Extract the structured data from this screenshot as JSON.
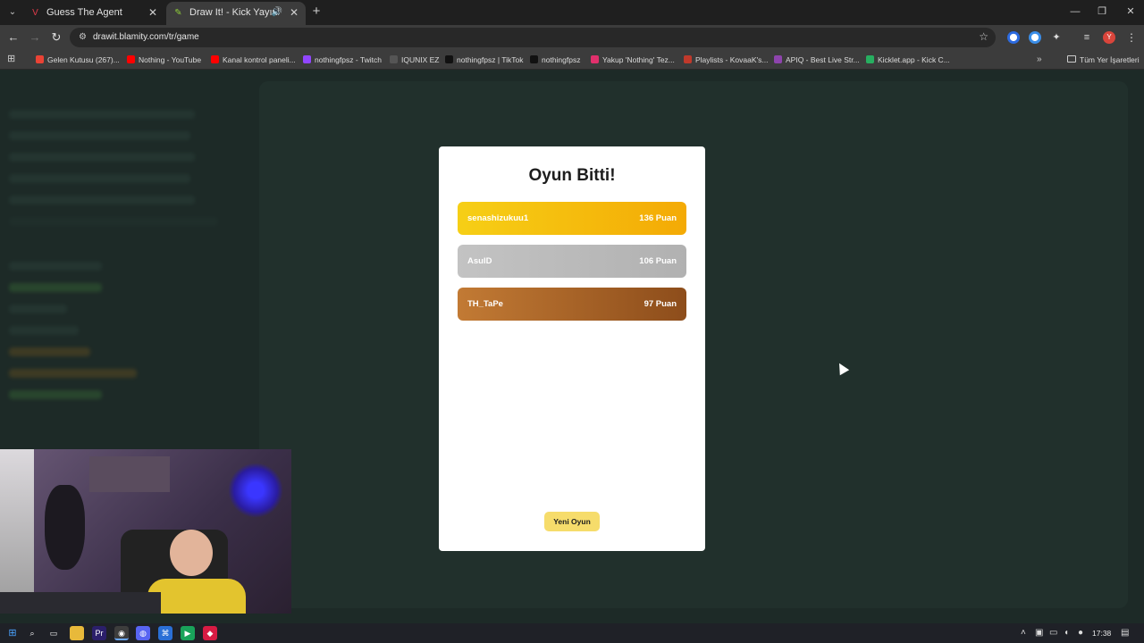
{
  "browser": {
    "tabs": [
      {
        "title": "Guess The Agent",
        "active": false,
        "favicon": "valorant-icon",
        "favicon_color": "#e23b4b"
      },
      {
        "title": "Draw It! - Kick Yayınları İçin",
        "active": true,
        "favicon": "pencil-icon",
        "favicon_color": "#8fce3a",
        "audio": true
      }
    ],
    "url": "drawit.blamity.com/tr/game",
    "profile_initial": "Y"
  },
  "bookmarks": [
    {
      "label": "Gelen Kutusu (267)...",
      "icon": "gmail-icon",
      "color": "#ea4335"
    },
    {
      "label": "Nothing - YouTube",
      "icon": "youtube-icon",
      "color": "#ff0000"
    },
    {
      "label": "Kanal kontrol paneli...",
      "icon": "youtube-studio-icon",
      "color": "#ff0000"
    },
    {
      "label": "nothingfpsz - Twitch",
      "icon": "twitch-icon",
      "color": "#9146ff"
    },
    {
      "label": "IQUNIX EZ",
      "icon": "iqunix-icon",
      "color": "#555555"
    },
    {
      "label": "nothingfpsz | TikTok",
      "icon": "tiktok-icon",
      "color": "#111111"
    },
    {
      "label": "nothingfpsz",
      "icon": "x-icon",
      "color": "#111111"
    },
    {
      "label": "Yakup 'Nothing' Tez...",
      "icon": "instagram-icon",
      "color": "#e1306c"
    },
    {
      "label": "Playlists - KovaaK's...",
      "icon": "kovaaks-icon",
      "color": "#c0392b"
    },
    {
      "label": "APIQ - Best Live Str...",
      "icon": "apiq-icon",
      "color": "#8e44ad"
    },
    {
      "label": "Kicklet.app - Kick C...",
      "icon": "kicklet-icon",
      "color": "#27ae60"
    }
  ],
  "bookmarks_folder": "Tüm Yer İşaretleri",
  "game_over": {
    "title": "Oyun Bitti!",
    "leaderboard": [
      {
        "name": "senashizukuu1",
        "score": "136 Puan"
      },
      {
        "name": "AsulD",
        "score": "106 Puan"
      },
      {
        "name": "TH_TaPe",
        "score": "97 Puan"
      }
    ],
    "new_game_label": "Yeni Oyun"
  },
  "taskbar": {
    "time": "17:38"
  },
  "colors": {
    "gold": "#f6cf16",
    "silver": "#c3c3c3",
    "bronze": "#c27a34",
    "button": "#f6dc6b"
  }
}
